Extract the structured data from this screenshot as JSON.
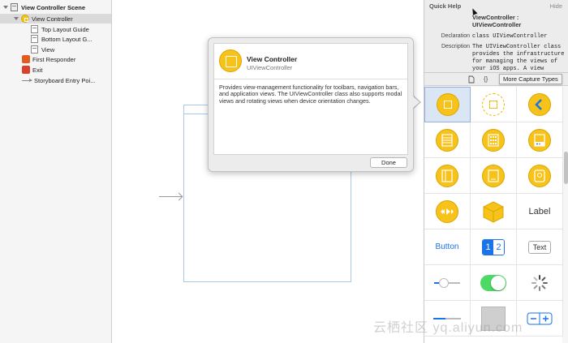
{
  "outline": {
    "items": [
      {
        "label": "View Controller Scene"
      },
      {
        "label": "View Controller"
      },
      {
        "label": "Top Layout Guide"
      },
      {
        "label": "Bottom Layout G..."
      },
      {
        "label": "View"
      },
      {
        "label": "First Responder"
      },
      {
        "label": "Exit"
      },
      {
        "label": "Storyboard Entry Poi..."
      }
    ]
  },
  "popover": {
    "title": "View Controller",
    "subtitle": "UIViewController",
    "description": "Provides view-management functionality for toolbars, navigation bars, and application views. The UIViewController class also supports modal views and rotating views when device orientation changes.",
    "done_label": "Done"
  },
  "quick_help": {
    "title": "Quick Help",
    "hide_label": "Hide",
    "name": "ViewController : UIViewController",
    "declaration_label": "Declaration",
    "declaration_value": "class UIViewController",
    "description_label": "Description",
    "description_value": "The UIViewController class provides the infrastructure for managing the views of your iOS apps. A view"
  },
  "library": {
    "tab_file_icon": "file-icon",
    "tab_code_icon": "{}",
    "tooltip": "More Capture Types",
    "label_item": "Label",
    "button_item": "Button",
    "segment_1": "1",
    "segment_2": "2",
    "textfield_item": "Text"
  },
  "colors": {
    "object_yellow": "#f7c21a",
    "accent_blue": "#1a73e8",
    "switch_green": "#4cd964"
  },
  "watermark": "云栖社区 yq.aliyun.com"
}
